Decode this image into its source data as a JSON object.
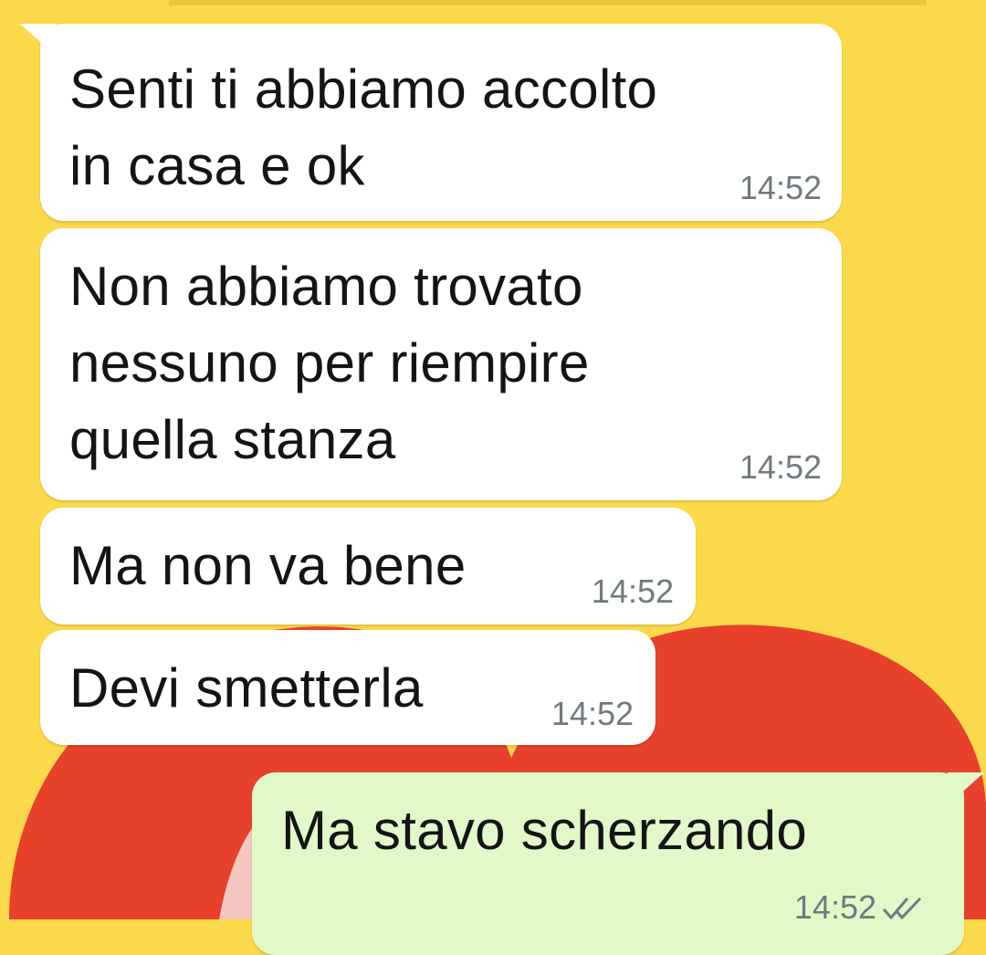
{
  "wallpaper": {
    "background": "#fbd94a",
    "accent": "#e8412b"
  },
  "chat": {
    "messages": [
      {
        "direction": "incoming",
        "text": "Senti ti abbiamo accolto\nin casa e ok",
        "time": "14:52"
      },
      {
        "direction": "incoming",
        "text": "Non abbiamo trovato\nnessuno per riempire\nquella stanza",
        "time": "14:52"
      },
      {
        "direction": "incoming",
        "text": "Ma non va bene",
        "time": "14:52"
      },
      {
        "direction": "incoming",
        "text": "Devi smetterla",
        "time": "14:52"
      },
      {
        "direction": "outgoing",
        "text": "Ma stavo scherzando",
        "time": "14:52",
        "status_icon": "double-check-icon"
      }
    ]
  }
}
